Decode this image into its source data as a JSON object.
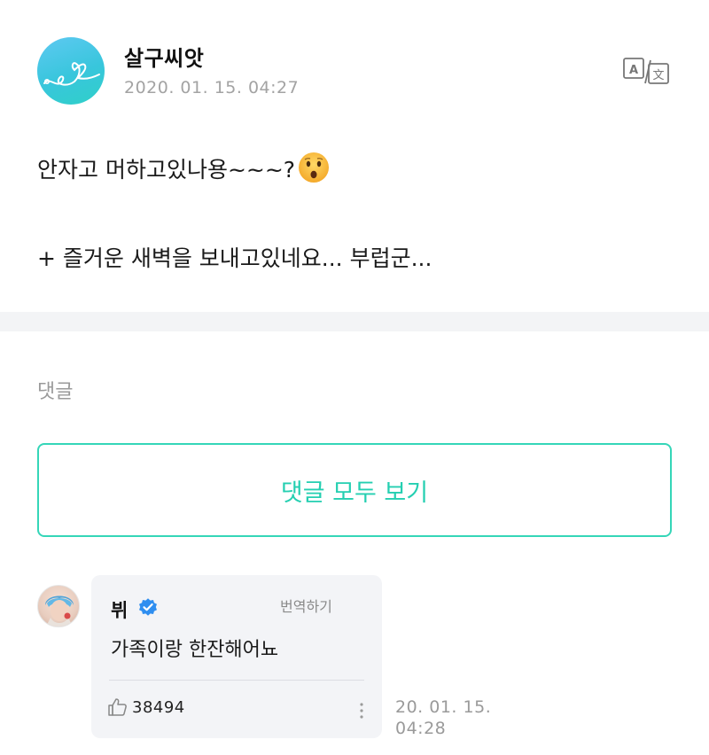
{
  "post": {
    "author_name": "살구씨앗",
    "date": "2020. 01. 15. 04:27",
    "lines": [
      "안자고 머하고있나용~~~?",
      "+  즐거운 새벽을 보내고있네요... 부럽군..."
    ],
    "emoji_icon": "hushed-face-emoji",
    "translate_icon": "translate-icon"
  },
  "comments": {
    "section_label": "댓글",
    "view_all_label": "댓글 모두 보기",
    "items": [
      {
        "name": "뷔",
        "verified_icon": "verified-badge-icon",
        "translate_label": "번역하기",
        "text": "가족이랑 한잔해어뇨",
        "like_icon": "thumbs-up-icon",
        "likes": "38494",
        "more_icon": "more-vertical-icon",
        "date_line1": "20. 01. 15.",
        "date_line2": "04:28"
      }
    ]
  },
  "colors": {
    "accent": "#24cfb1",
    "verified": "#2f8ef0",
    "muted": "#9a9a9a",
    "band": "#f3f4f6"
  }
}
